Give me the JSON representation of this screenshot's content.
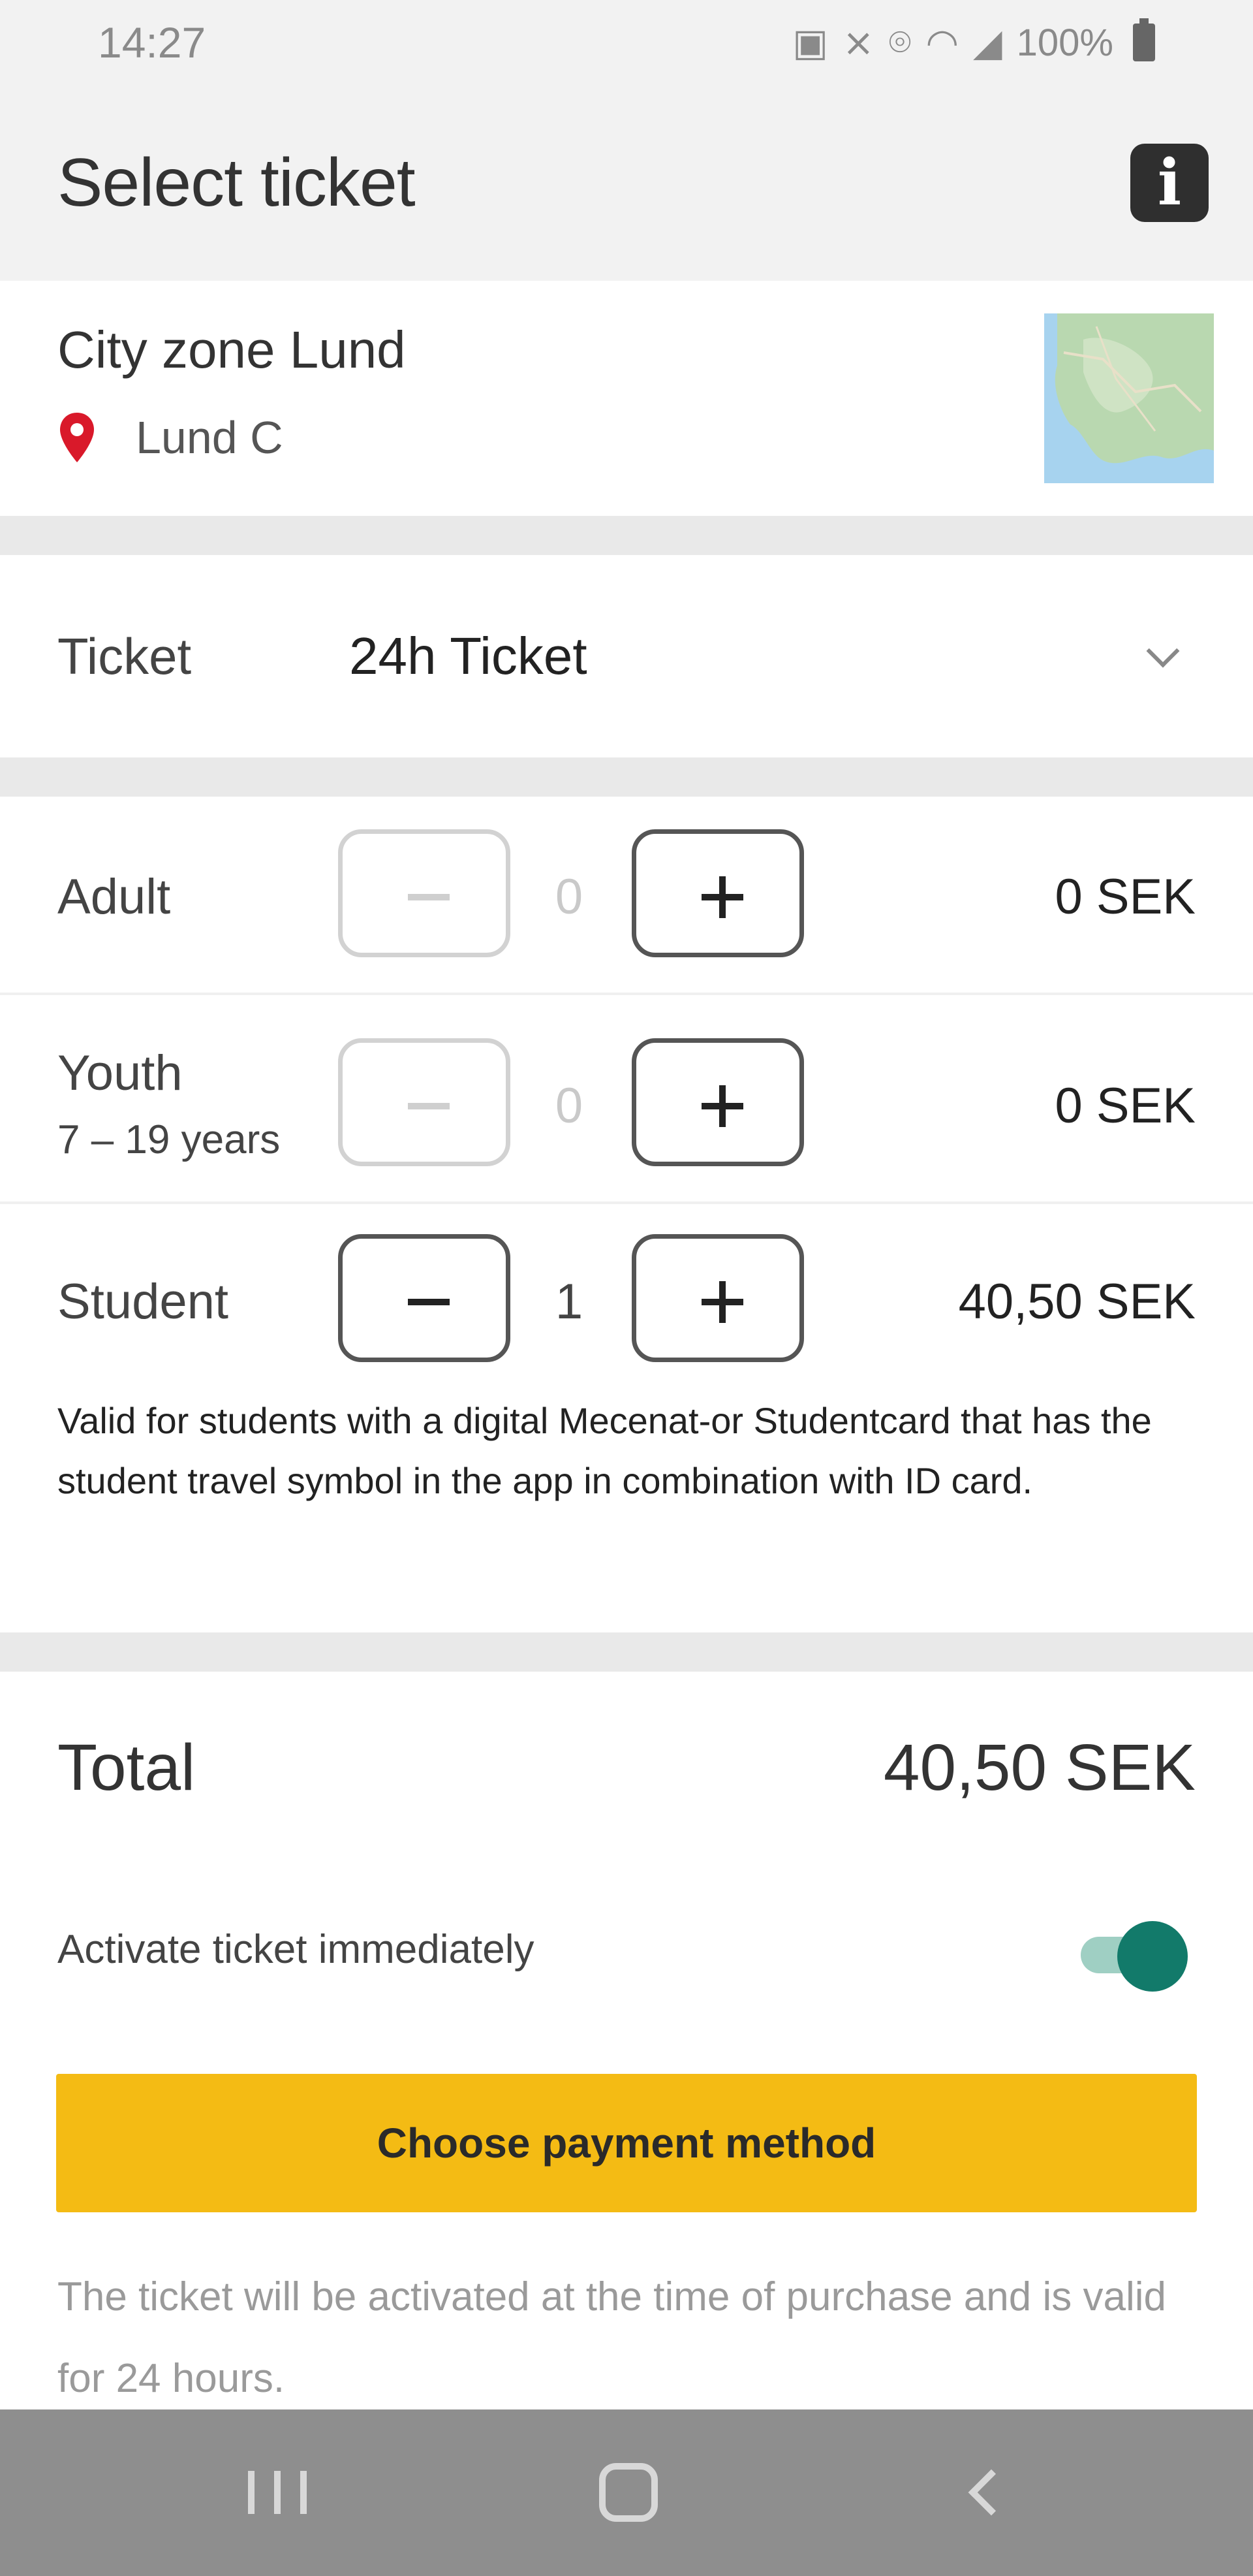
{
  "status_bar": {
    "time": "14:27",
    "battery": "100%"
  },
  "app_bar": {
    "title": "Select ticket",
    "info_icon_glyph": "i"
  },
  "zone": {
    "name": "City zone Lund",
    "stop": "Lund C"
  },
  "ticket": {
    "label": "Ticket",
    "value": "24h Ticket"
  },
  "passengers": [
    {
      "label": "Adult",
      "sublabel": "",
      "quantity": "0",
      "price": "0 SEK"
    },
    {
      "label": "Youth",
      "sublabel": "7 – 19 years",
      "quantity": "0",
      "price": "0 SEK"
    },
    {
      "label": "Student",
      "sublabel": "",
      "quantity": "1",
      "price": "40,50 SEK"
    }
  ],
  "student_note": "Valid for students with a digital Mecenat-or Studentcard that has the student travel symbol in the app in combination with ID card.",
  "total": {
    "label": "Total",
    "value": "40,50 SEK"
  },
  "activate": {
    "label": "Activate ticket immediately",
    "enabled": true
  },
  "pay_button_label": "Choose payment method",
  "footnote": "The ticket will be activated at the time of purchase and is valid for 24 hours.",
  "colors": {
    "accent_button": "#f4bb14",
    "toggle_on": "#127a6a",
    "pin": "#d9192a"
  }
}
